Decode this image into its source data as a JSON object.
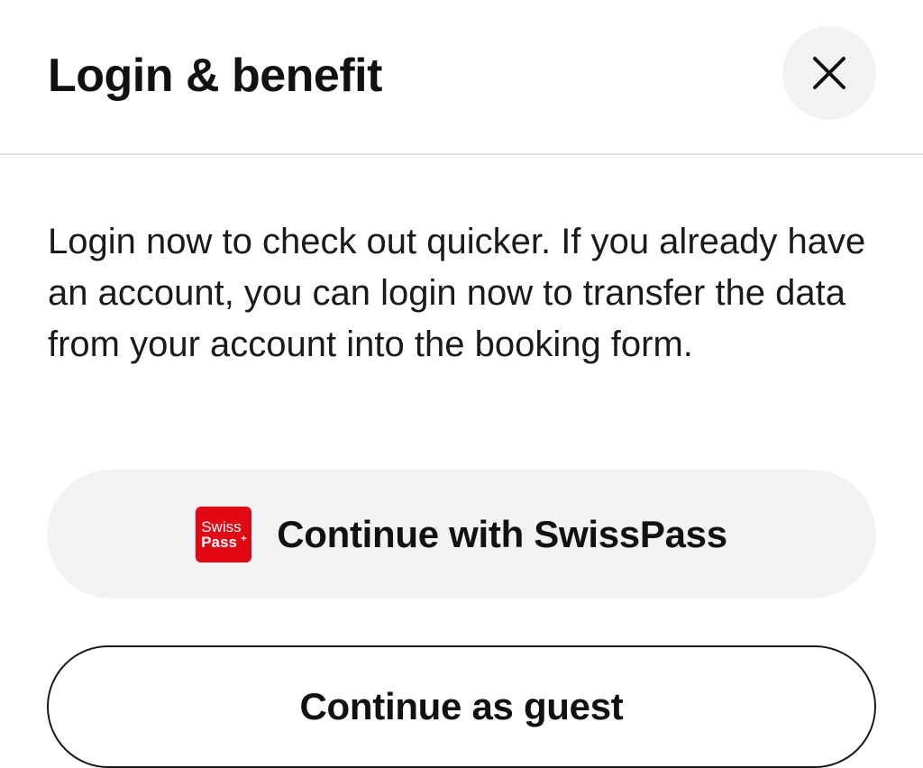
{
  "dialog": {
    "title": "Login & benefit",
    "close_icon": "close-icon",
    "message": "Login now to check out quicker. If you already have an account, you can login now to transfer the data from your account into the booking form.",
    "swisspass_button": {
      "label": "Continue with SwissPass",
      "logo_line1": "Swiss",
      "logo_line2": "Pass",
      "logo_plus": "+"
    },
    "guest_button": {
      "label": "Continue as guest"
    }
  },
  "colors": {
    "swisspass_red": "#e30613",
    "button_bg": "#f1f2f3",
    "text": "#111111"
  }
}
